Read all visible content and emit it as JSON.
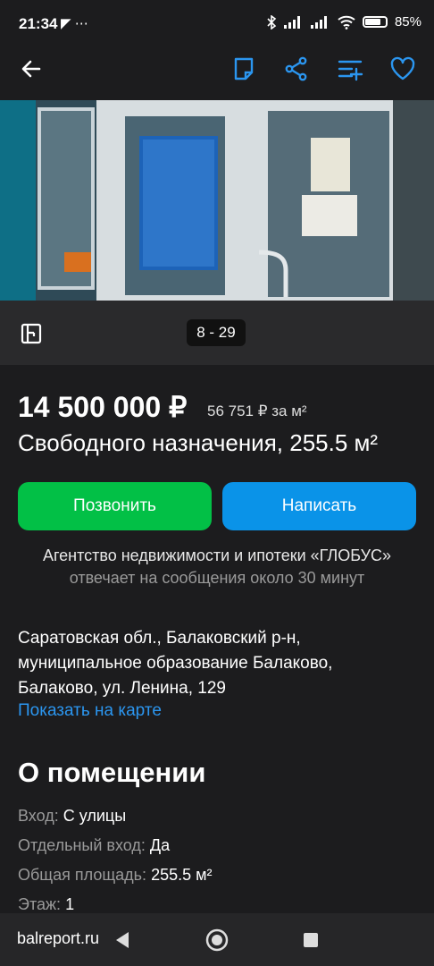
{
  "status_bar": {
    "time": "21:34",
    "notif_icons": "◤ ⋯",
    "battery": "85%",
    "icons": [
      "bluetooth-icon",
      "signal-icon",
      "wifi-icon",
      "battery-icon"
    ]
  },
  "app_bar": {
    "icons": [
      "back-arrow-icon",
      "note-icon",
      "share-icon",
      "compare-icon",
      "favorite-heart-icon"
    ]
  },
  "gallery": {
    "counter": "8 - 29"
  },
  "listing": {
    "price": "14 500 000 ₽",
    "price_per_m2": "56 751 ₽ за м²",
    "title": "Свободного назначения, 255.5 м²"
  },
  "actions": {
    "call_label": "Позвонить",
    "write_label": "Написать"
  },
  "seller": {
    "agency": "Агентство недвижимости и ипотеки «ГЛОБУС»",
    "response": "отвечает на сообщения около 30 минут"
  },
  "address": {
    "text": "Саратовская обл., Балаковский р-н, муниципальное образование Балаково, Балаково, ул. Ленина, 129",
    "map_link": "Показать на карте"
  },
  "about": {
    "heading": "О помещении",
    "props": [
      {
        "k": "Вход:",
        "v": "С улицы"
      },
      {
        "k": "Отдельный вход:",
        "v": "Да"
      },
      {
        "k": "Общая площадь:",
        "v": "255.5 м²"
      },
      {
        "k": "Этаж:",
        "v": "1"
      }
    ]
  },
  "nav_bar": {
    "site": "balreport.ru"
  },
  "colors": {
    "background": "#1c1c1e",
    "green": "#02c046",
    "blue": "#0a93e8",
    "accent_icons": "#2b96f0"
  }
}
